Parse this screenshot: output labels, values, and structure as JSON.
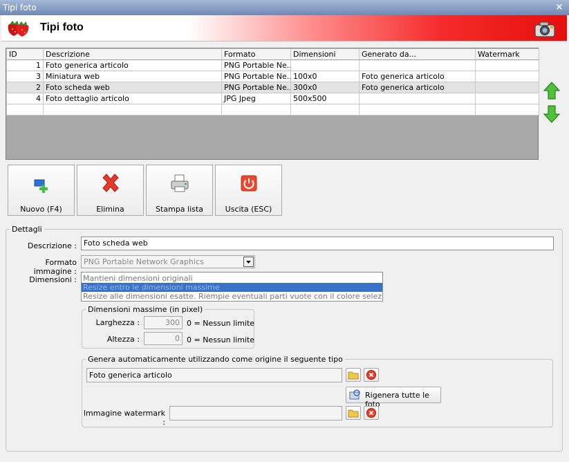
{
  "window": {
    "title": "Tipi foto",
    "close_glyph": "×"
  },
  "header": {
    "title": "Tipi foto",
    "left_icon": "strawberries-icon",
    "right_icon": "camera-icon"
  },
  "grid": {
    "columns": [
      "ID",
      "Descrizione",
      "Formato",
      "Dimensioni",
      "Generato da...",
      "Watermark"
    ],
    "rows": [
      {
        "id": "1",
        "descrizione": "Foto generica articolo",
        "formato": "PNG Portable Ne...",
        "dimensioni": "",
        "generato": "",
        "watermark": ""
      },
      {
        "id": "3",
        "descrizione": "Miniatura web",
        "formato": "PNG Portable Ne...",
        "dimensioni": "100x0",
        "generato": "Foto generica articolo",
        "watermark": ""
      },
      {
        "id": "2",
        "descrizione": "Foto scheda web",
        "formato": "PNG Portable Ne...",
        "dimensioni": "300x0",
        "generato": "Foto generica articolo",
        "watermark": ""
      },
      {
        "id": "4",
        "descrizione": "Foto dettaglio articolo",
        "formato": "JPG Jpeg",
        "dimensioni": "500x500",
        "generato": "",
        "watermark": ""
      }
    ]
  },
  "toolbar": {
    "nuovo": "Nuovo (F4)",
    "elimina": "Elimina",
    "stampa": "Stampa lista",
    "uscita": "Uscita (ESC)"
  },
  "details": {
    "legend": "Dettagli",
    "descrizione_label": "Descrizione :",
    "descrizione_value": "Foto scheda web",
    "formato_label": "Formato immagine :",
    "formato_value": "PNG Portable Network Graphics",
    "dimensioni_label": "Dimensioni :",
    "dimensioni_options": [
      "Mantieni dimensioni originali",
      "Resize entro le dimensioni massime",
      "Resize alle dimensioni esatte. Riempie eventuali parti vuote con il colore selezionato."
    ],
    "max_dims": {
      "legend": "Dimensioni massime (in pixel)",
      "larghezza_label": "Larghezza :",
      "larghezza_value": "300",
      "altezza_label": "Altezza :",
      "altezza_value": "0",
      "hint": "0 = Nessun limite"
    },
    "genera": {
      "legend": "Genera automaticamente utilizzando come origine il seguente tipo",
      "origine_value": "Foto generica articolo",
      "rigenera_label": "Rigenera tutte le foto",
      "watermark_label": "Immagine watermark :",
      "watermark_value": ""
    }
  }
}
